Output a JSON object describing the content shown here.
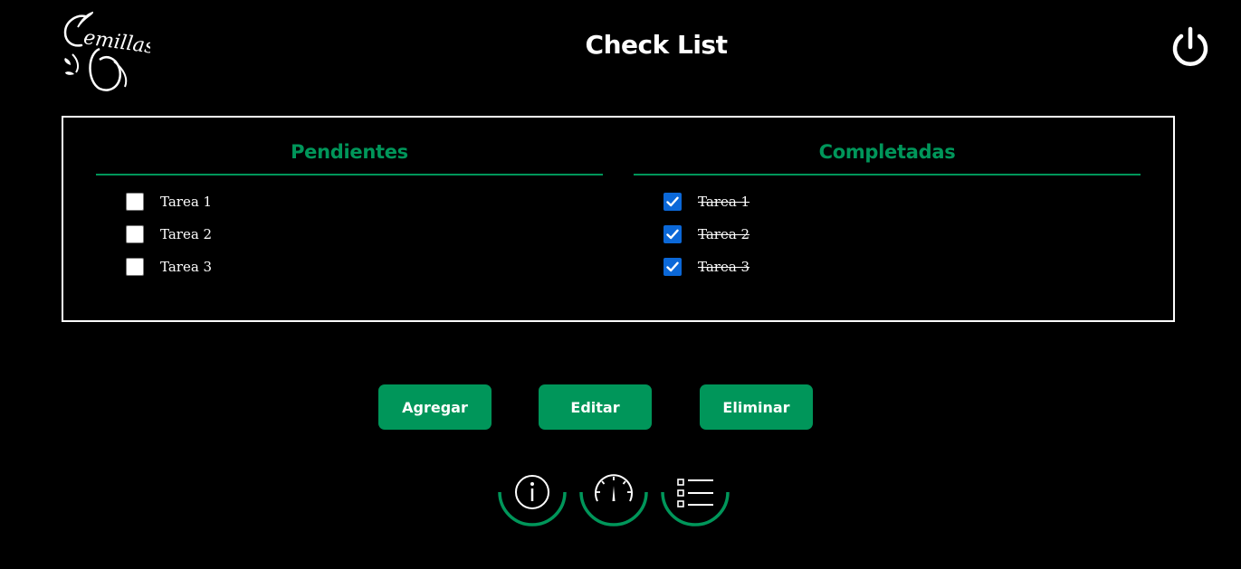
{
  "header": {
    "title": "Check List",
    "logo_text": "emillas"
  },
  "pending": {
    "heading": "Pendientes",
    "tasks": [
      {
        "label": "Tarea 1",
        "checked": false
      },
      {
        "label": "Tarea 2",
        "checked": false
      },
      {
        "label": "Tarea 3",
        "checked": false
      }
    ]
  },
  "completed": {
    "heading": "Completadas",
    "tasks": [
      {
        "label": "Tarea 1",
        "checked": true
      },
      {
        "label": "Tarea 2",
        "checked": true
      },
      {
        "label": "Tarea 3",
        "checked": true
      }
    ]
  },
  "actions": {
    "add_label": "Agregar",
    "edit_label": "Editar",
    "delete_label": "Eliminar"
  },
  "icons": {
    "power": "power-icon",
    "info": "info-icon",
    "gauge": "gauge-icon",
    "checklist": "checklist-icon"
  },
  "colors": {
    "accent": "#00965a",
    "checkbox_checked": "#0b68d8",
    "background": "#000000",
    "text": "#ffffff"
  }
}
